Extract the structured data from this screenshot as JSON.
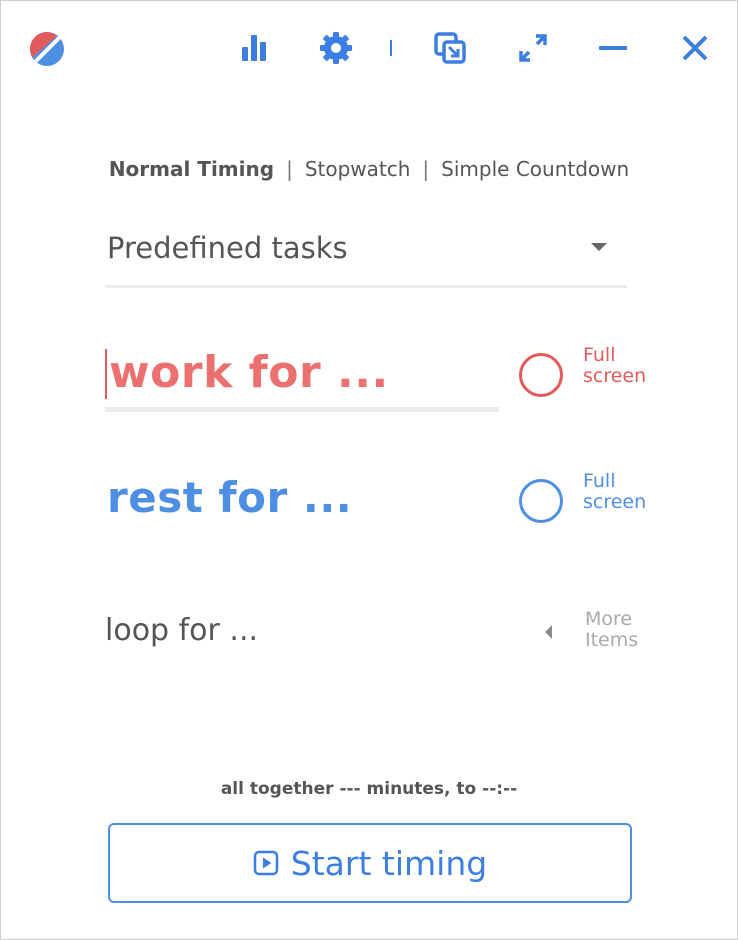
{
  "titlebar": {
    "icons": [
      "app-logo",
      "stats-icon",
      "settings-icon",
      "pop-out-icon",
      "fullscreen-icon",
      "minimize-icon",
      "close-icon"
    ],
    "accent_color": "#3d7fe0"
  },
  "modes": {
    "normal": "Normal Timing",
    "stopwatch": "Stopwatch",
    "countdown": "Simple Countdown",
    "separator": "|",
    "active": "normal"
  },
  "task_select": {
    "value": "Predefined tasks"
  },
  "work": {
    "placeholder": "work for ...",
    "fullscreen_label_1": "Full",
    "fullscreen_label_2": "screen",
    "color": "#e35a5a"
  },
  "rest": {
    "placeholder": "rest for ...",
    "fullscreen_label_1": "Full",
    "fullscreen_label_2": "screen",
    "color": "#4f8fe3"
  },
  "loop": {
    "placeholder": "loop for ...",
    "more_label_1": "More",
    "more_label_2": "Items"
  },
  "summary": {
    "text": "all together --- minutes, to --:--"
  },
  "start_button": {
    "label": "Start timing"
  }
}
